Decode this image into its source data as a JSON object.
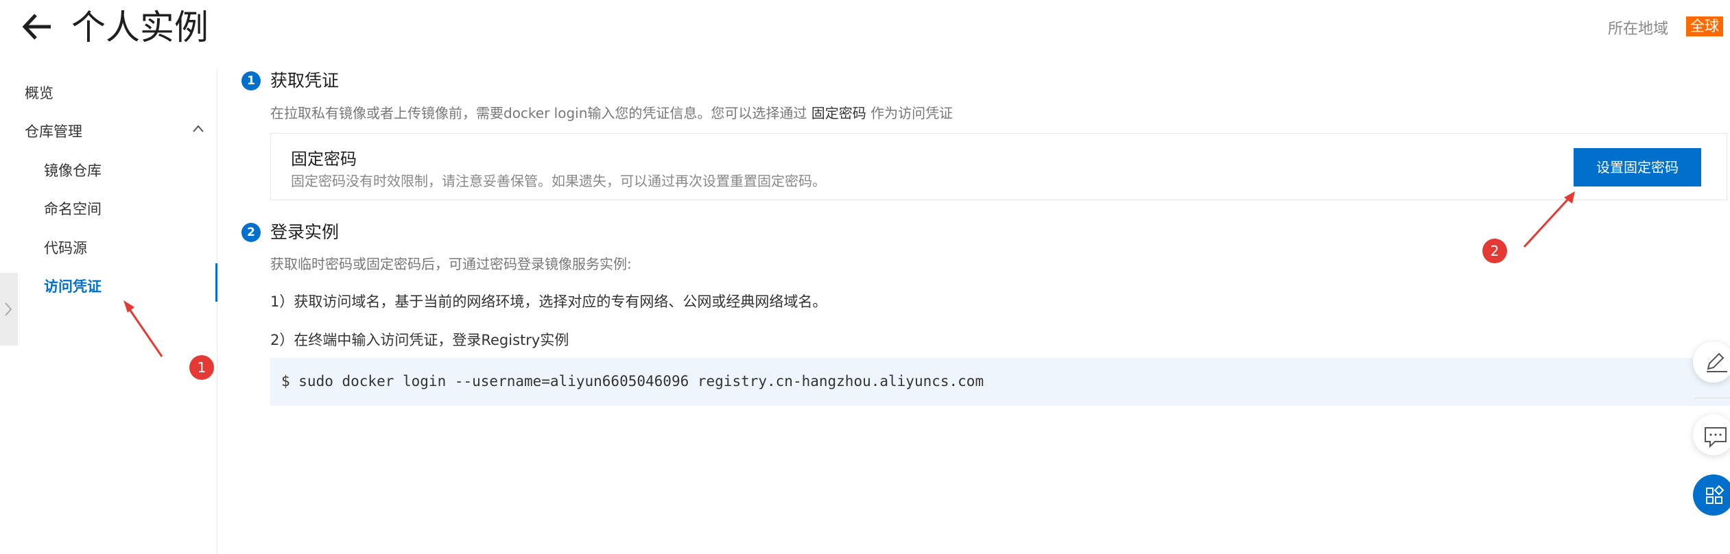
{
  "header": {
    "title": "个人实例",
    "region_label": "所在地域",
    "region_value": "全球"
  },
  "sidebar": {
    "items": [
      {
        "label": "概览"
      },
      {
        "label": "仓库管理"
      },
      {
        "label": "镜像仓库"
      },
      {
        "label": "命名空间"
      },
      {
        "label": "代码源"
      },
      {
        "label": "访问凭证"
      }
    ]
  },
  "step1": {
    "number": "1",
    "title": "获取凭证",
    "desc_prefix": "在拉取私有镜像或者上传镜像前，需要docker login输入您的凭证信息。您可以选择通过",
    "desc_strong": "固定密码",
    "desc_suffix": "作为访问凭证",
    "card_title": "固定密码",
    "card_desc": "固定密码没有时效限制，请注意妥善保管。如果遗失，可以通过再次设置重置固定密码。",
    "button_label": "设置固定密码"
  },
  "step2": {
    "number": "2",
    "title": "登录实例",
    "desc": "获取临时密码或固定密码后，可通过密码登录镜像服务实例:",
    "line1": "1）获取访问域名，基于当前的网络环境，选择对应的专有网络、公网或经典网络域名。",
    "line2": "2）在终端中输入访问凭证，登录Registry实例",
    "command": "$ sudo docker login --username=aliyun6605046096 registry.cn-hangzhou.aliyuncs.com"
  },
  "annotations": {
    "a1": "1",
    "a2": "2"
  },
  "colors": {
    "accent": "#0070cc",
    "region_badge": "#ff6a00",
    "annotation": "#e53935",
    "code_bg": "#eef5fc"
  },
  "icons": [
    "back-arrow-icon",
    "chevron-up-icon",
    "chevron-right-icon",
    "edit-icon",
    "chat-icon",
    "apps-icon"
  ]
}
